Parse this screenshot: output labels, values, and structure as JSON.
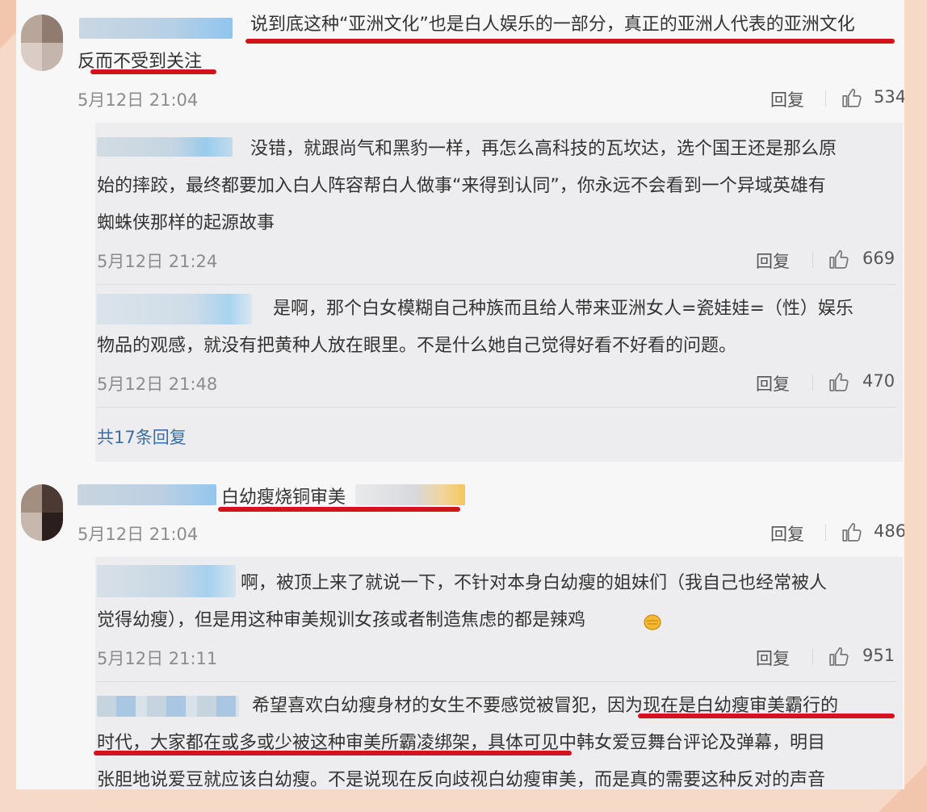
{
  "comments": [
    {
      "text_line1": "说到底这种“亚洲文化”也是白人娱乐的一部分，真正的亚洲人代表的亚洲文化",
      "text_line2": "反而不受到关注",
      "time": "5月12日 21:04",
      "reply_label": "回复",
      "likes": "534",
      "replies": [
        {
          "lines": [
            "没错，就跟尚气和黑豹一样，再怎么高科技的瓦坎达，选个国王还是那么原",
            "始的摔跤，最终都要加入白人阵容帮白人做事“来得到认同”，你永远不会看到一个异域英雄有",
            "蜘蛛侠那样的起源故事"
          ],
          "time": "5月12日 21:24",
          "reply_label": "回复",
          "likes": "669"
        },
        {
          "lines": [
            "是啊，那个白女模糊自己种族而且给人带来亚洲女人=瓷娃娃=（性）娱乐",
            "物品的观感，就没有把黄种人放在眼里。不是什么她自己觉得好看不好看的问题。"
          ],
          "time": "5月12日 21:48",
          "reply_label": "回复",
          "likes": "470"
        }
      ],
      "more_replies": "共17条回复"
    },
    {
      "text_line1": "白幼瘦烧铜审美",
      "time": "5月12日 21:04",
      "reply_label": "回复",
      "likes": "486",
      "replies": [
        {
          "lines": [
            "啊，被顶上来了就说一下，不针对本身白幼瘦的姐妹们（我自己也经常被人",
            "觉得幼瘦），但是用这种审美规训女孩或者制造焦虑的都是辣鸡"
          ],
          "time": "5月12日 21:11",
          "reply_label": "回复",
          "likes": "951"
        },
        {
          "lines": [
            "希望喜欢白幼瘦身材的女生不要感觉被冒犯，因为现在是白幼瘦审美霸行的",
            "时代，大家都在或多或少被这种审美所霸凌绑架，具体可见中韩女爱豆舞台评论及弹幕，明目",
            "张胆地说爱豆就应该白幼瘦。不是说现在反向歧视白幼瘦审美，而是真的需要这种反对的声音"
          ]
        }
      ]
    }
  ],
  "icons": {
    "like": "thumbs-up-icon",
    "emoji": "fist-emoji-icon"
  },
  "colors": {
    "highlight": "#d4141c",
    "link": "#3a6ea5",
    "frame": "#f6d9c6"
  }
}
